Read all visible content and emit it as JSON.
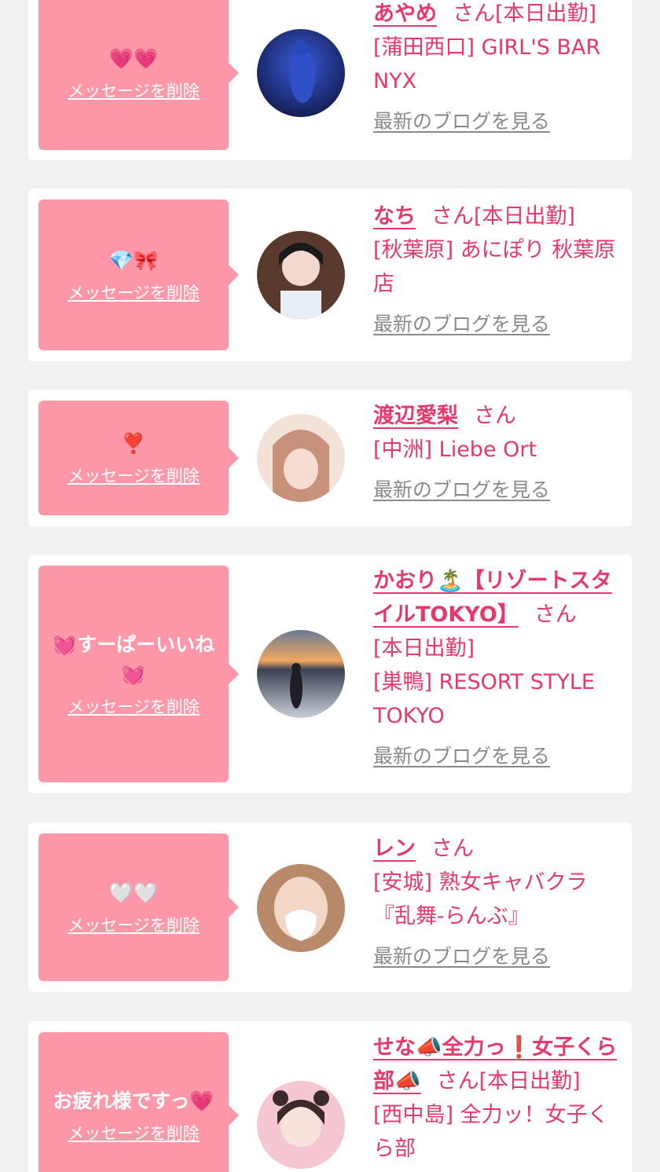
{
  "cards": [
    {
      "message": "💗💗",
      "delete_label": "メッセージを削除",
      "name": "あやめ",
      "honorific": "さん",
      "status": "[本日出勤]",
      "shop": "[蒲田西口] GIRL'S BAR NYX",
      "blog_link": "最新のブログを見る"
    },
    {
      "message": "💎🎀",
      "delete_label": "メッセージを削除",
      "name": "なち",
      "honorific": "さん",
      "status": "[本日出勤]",
      "shop": "[秋葉原] あにぽり 秋葉原店",
      "blog_link": "最新のブログを見る"
    },
    {
      "message": "❣️",
      "delete_label": "メッセージを削除",
      "name": "渡辺愛梨",
      "honorific": "さん",
      "status": "",
      "shop": "[中洲] Liebe Ort",
      "blog_link": "最新のブログを見る"
    },
    {
      "message": "💓すーぱーいいね💓",
      "delete_label": "メッセージを削除",
      "name": "かおり🏝️【リゾートスタイルTOKYO】",
      "honorific": "さん",
      "status": "[本日出勤]",
      "shop": "[巣鴨] RESORT STYLE TOKYO",
      "blog_link": "最新のブログを見る"
    },
    {
      "message": "🤍🤍",
      "delete_label": "メッセージを削除",
      "name": "レン",
      "honorific": "さん",
      "status": "",
      "shop": "[安城] 熟女キャバクラ『乱舞-らんぶ』",
      "blog_link": "最新のブログを見る"
    },
    {
      "message": "お疲れ様ですっ💗",
      "delete_label": "メッセージを削除",
      "name": "せな📣全力っ❗️女子くら部📣",
      "honorific": "さん",
      "status": "[本日出勤]",
      "shop": "[西中島] 全力ッ！女子くら部",
      "blog_link": ""
    }
  ]
}
